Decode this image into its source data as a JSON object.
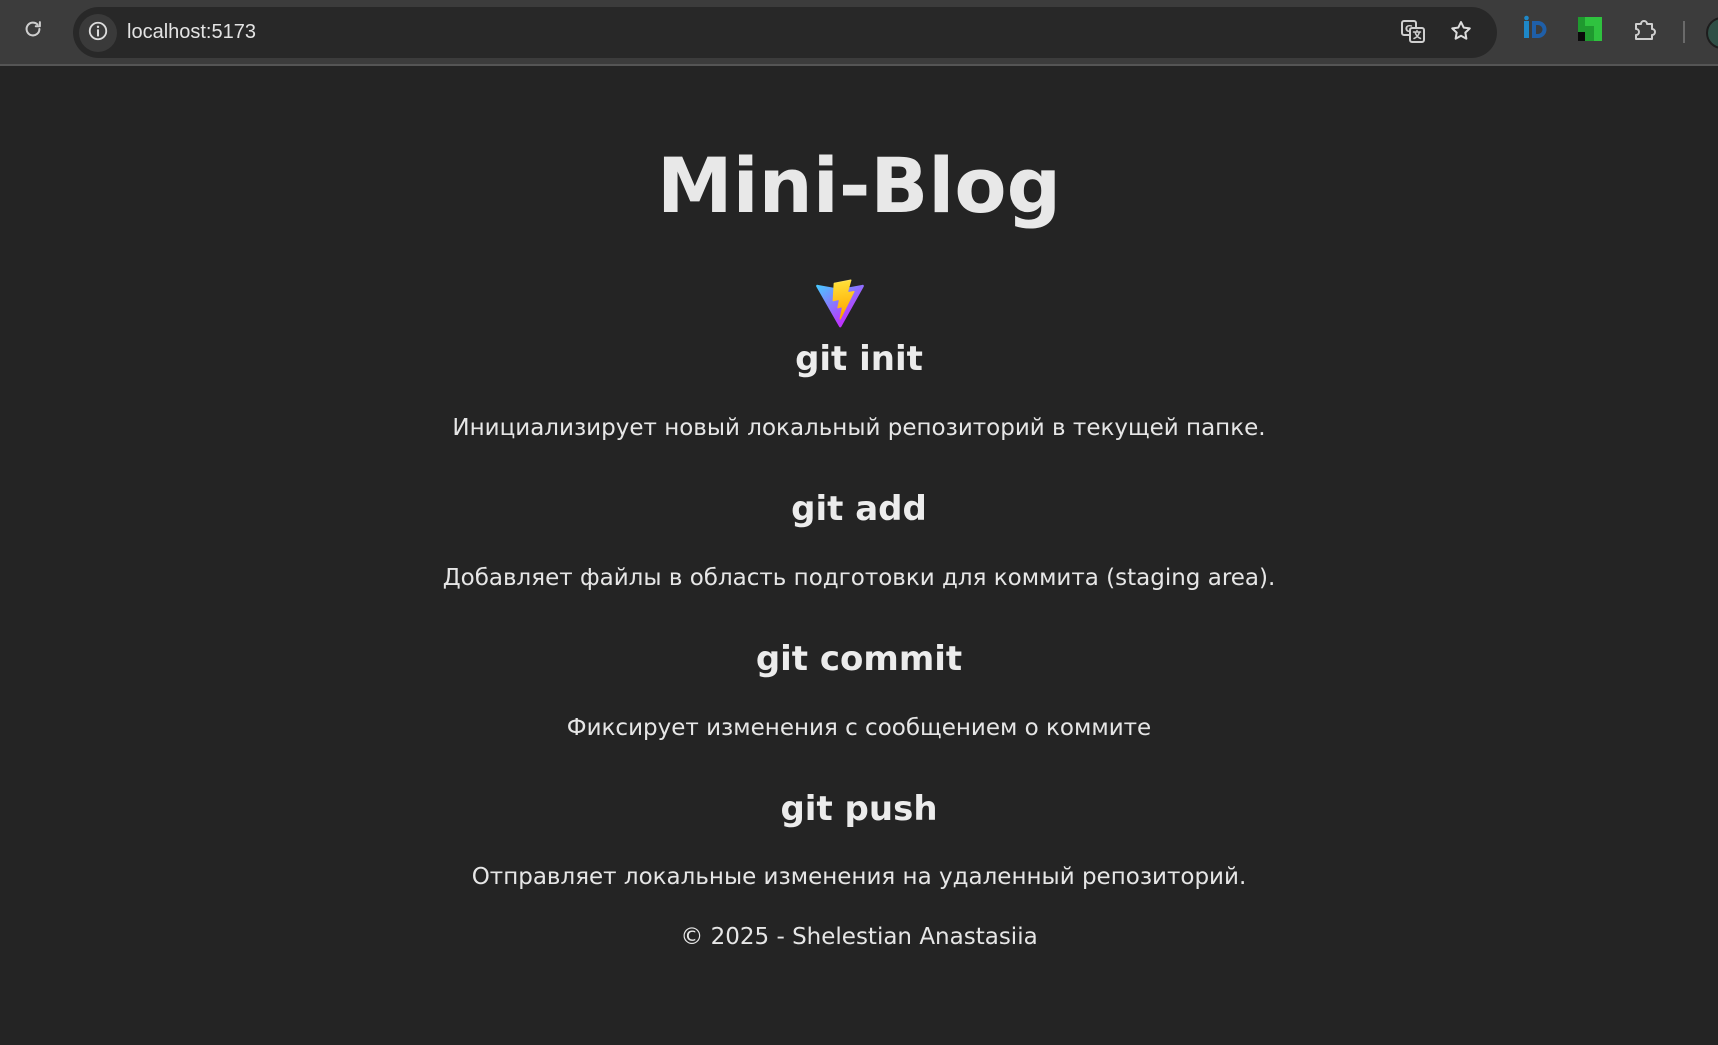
{
  "browser": {
    "url": "localhost:5173",
    "icons": {
      "reload": "reload-icon",
      "site_info": "info-icon",
      "translate": "translate-icon",
      "bookmark": "star-icon",
      "extension_1": "id-extension-icon",
      "extension_2": "green-extension-icon",
      "extensions_menu": "puzzle-icon",
      "profile": "avatar"
    }
  },
  "page": {
    "title": "Mini-Blog",
    "logo": "vite-logo",
    "commands": [
      {
        "name": "git init",
        "description": "Инициализирует новый локальный репозиторий в текущей папке."
      },
      {
        "name": "git add",
        "description": "Добавляет файлы в область подготовки для коммита (staging area)."
      },
      {
        "name": "git commit",
        "description": "Фиксирует изменения с сообщением о коммите"
      },
      {
        "name": "git push",
        "description": "Отправляет локальные изменения на удаленный репозиторий."
      }
    ],
    "footer": "© 2025 - Shelestian Anastasiia"
  },
  "colors": {
    "page_background": "#242424",
    "toolbar_background": "#3c3c3c",
    "omnibox_background": "#282828",
    "text": "#e6e6e6"
  }
}
